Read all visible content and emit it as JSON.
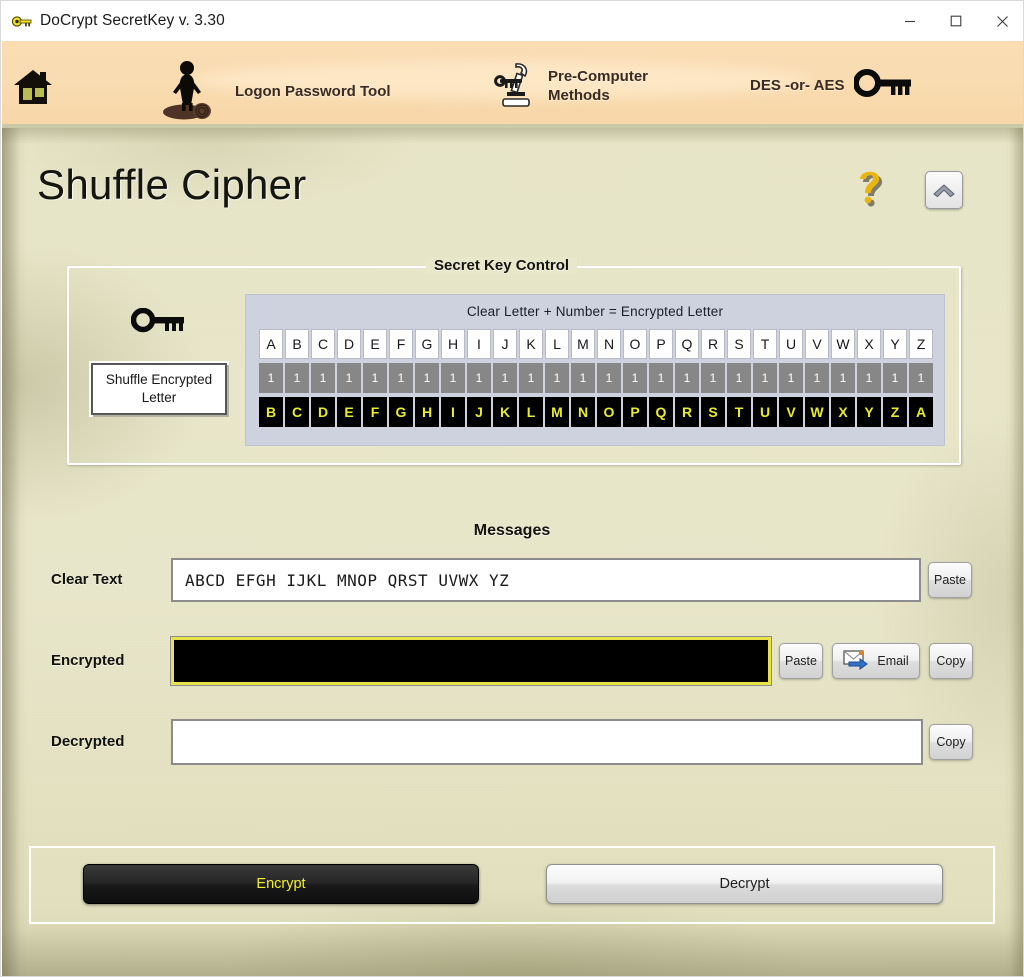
{
  "window": {
    "title": "DoCrypt SecretKey v. 3.30",
    "app_icon": "key-icon",
    "minimize_label": "—",
    "maximize_label": "□",
    "close_label": "✕"
  },
  "toolbar": {
    "items": [
      {
        "id": "home",
        "label": "",
        "icon": "house-icon"
      },
      {
        "id": "logon",
        "label": "Logon Password Tool",
        "icon": "woman-on-log-icon"
      },
      {
        "id": "precomputer",
        "label_line1": "Pre-Computer",
        "label_line2": "Methods",
        "icon": "microscope-icon"
      },
      {
        "id": "desaes",
        "label": "DES -or- AES",
        "icon": "key-icon"
      }
    ]
  },
  "page": {
    "title": "Shuffle Cipher",
    "help_icon": "question-mark-icon",
    "collapse_icon": "chevron-up-icon"
  },
  "secret_key": {
    "legend": "Secret Key Control",
    "key_icon": "key-icon",
    "shuffle_button_label": "Shuffle Encrypted Letter",
    "grid_caption": "Clear Letter  + Number  =  Encrypted Letter",
    "clear_letters": [
      "A",
      "B",
      "C",
      "D",
      "E",
      "F",
      "G",
      "H",
      "I",
      "J",
      "K",
      "L",
      "M",
      "N",
      "O",
      "P",
      "Q",
      "R",
      "S",
      "T",
      "U",
      "V",
      "W",
      "X",
      "Y",
      "Z"
    ],
    "numbers": [
      "1",
      "1",
      "1",
      "1",
      "1",
      "1",
      "1",
      "1",
      "1",
      "1",
      "1",
      "1",
      "1",
      "1",
      "1",
      "1",
      "1",
      "1",
      "1",
      "1",
      "1",
      "1",
      "1",
      "1",
      "1",
      "1"
    ],
    "encrypted_letters": [
      "B",
      "C",
      "D",
      "E",
      "F",
      "G",
      "H",
      "I",
      "J",
      "K",
      "L",
      "M",
      "N",
      "O",
      "P",
      "Q",
      "R",
      "S",
      "T",
      "U",
      "V",
      "W",
      "X",
      "Y",
      "Z",
      "A"
    ]
  },
  "messages": {
    "title": "Messages",
    "clear_text": {
      "label": "Clear Text",
      "value": "ABCD EFGH IJKL MNOP QRST UVWX YZ",
      "paste_label": "Paste"
    },
    "encrypted": {
      "label": "Encrypted",
      "value": "",
      "paste_label": "Paste",
      "email_label": "Email",
      "email_icon": "email-send-icon",
      "copy_label": "Copy"
    },
    "decrypted": {
      "label": "Decrypted",
      "value": "",
      "copy_label": "Copy"
    }
  },
  "actions": {
    "encrypt_label": "Encrypt",
    "decrypt_label": "Decrypt"
  },
  "colors": {
    "toolbar_bg": "#fadcb2",
    "parchment_bg": "#e9e7c9",
    "grid_panel_bg": "#ced2de",
    "encrypted_cell_bg": "#000000",
    "encrypted_cell_fg": "#e9ec2a",
    "number_cell_bg": "#878787",
    "encrypt_button_bg": "#1a1a1a",
    "encrypt_button_fg": "#f2ef2e",
    "field_highlight_border": "#e9e24a"
  }
}
